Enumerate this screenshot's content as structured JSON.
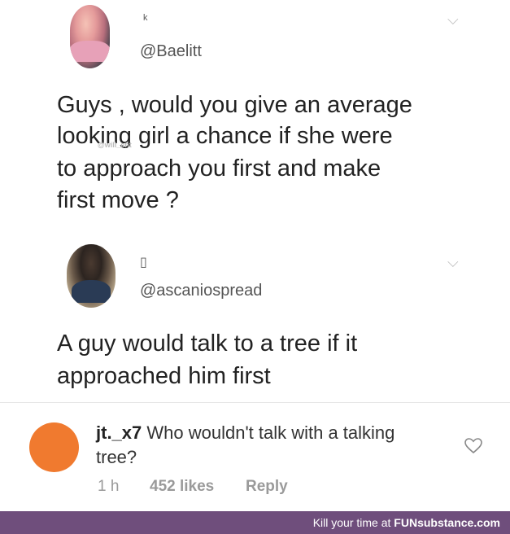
{
  "post1": {
    "handle": "@Baelitt",
    "name_glyph": "ᵏ",
    "text_lines": [
      "Guys , would you give an average",
      "looking girl a chance if she were",
      "to approach you first and make",
      "first move ?"
    ],
    "watermark": "@will_ent"
  },
  "post2": {
    "handle": "@ascaniospread",
    "name_glyph": "▯",
    "text_lines": [
      "A guy would talk to a tree if it",
      "approached him first"
    ]
  },
  "comment": {
    "username": "jt._x7",
    "text_line1": "Who wouldn't talk with a talking",
    "text_line2": "tree?",
    "time": "1 h",
    "likes": "452 likes",
    "reply": "Reply"
  },
  "footer": {
    "prefix": "Kill your time at",
    "brand": "FUNsubstance.com"
  },
  "colors": {
    "commenter_avatar": "#f07a2f",
    "footer_bg": "#6f4e7c"
  },
  "icons": [
    "chevron-down-icon",
    "heart-icon"
  ]
}
